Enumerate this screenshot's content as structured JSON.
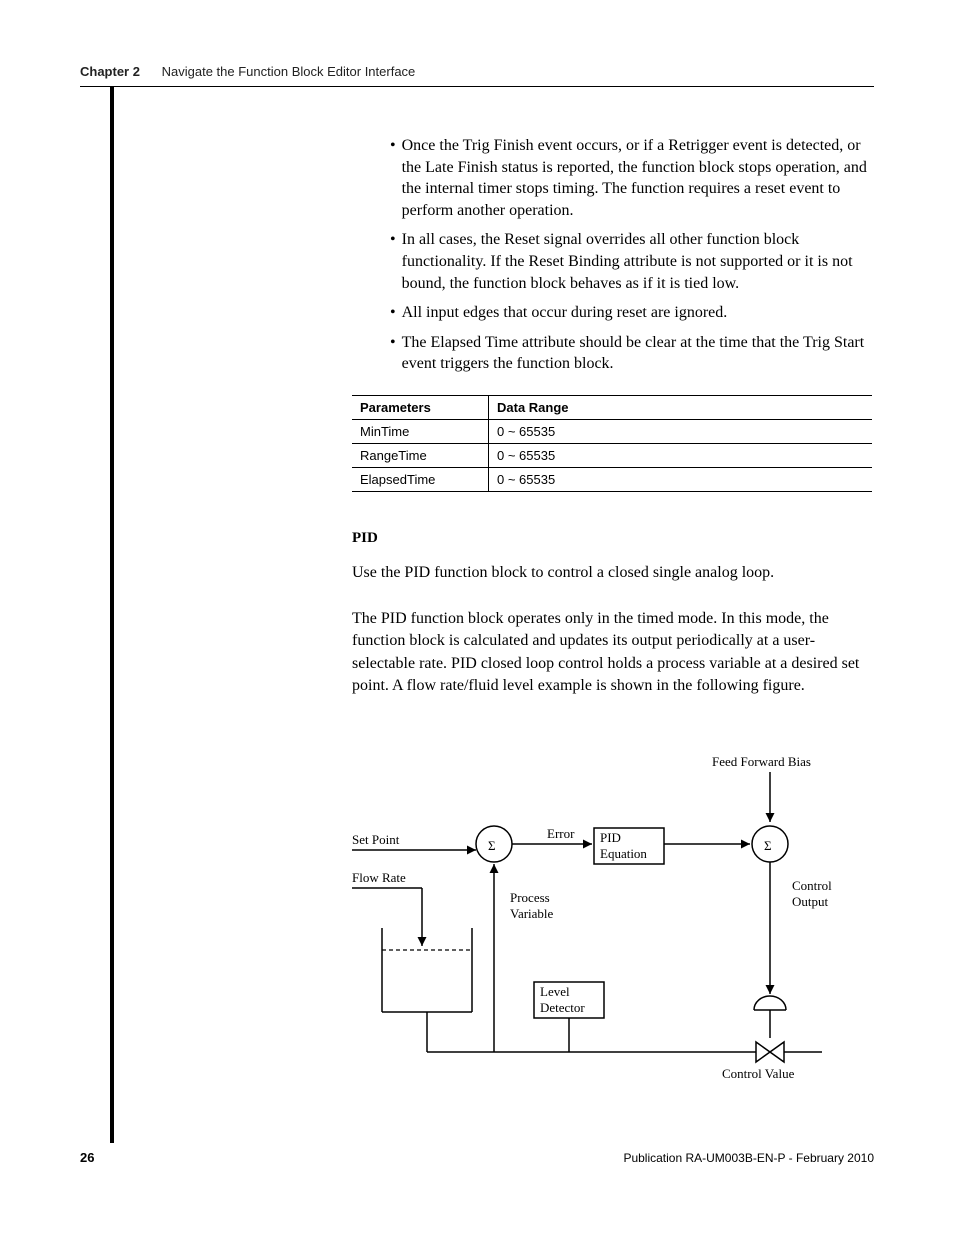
{
  "header": {
    "chapter_label": "Chapter 2",
    "chapter_title": "Navigate the Function Block Editor Interface"
  },
  "bullets": [
    "Once the Trig Finish event occurs, or if a Retrigger event is detected, or the Late Finish status is reported, the function block stops operation, and the internal timer stops timing. The function requires a reset event to perform another operation.",
    "In all cases, the Reset signal overrides all other function block functionality. If the Reset Binding attribute is not supported or it is not bound, the function block behaves as if it is tied low.",
    "All input edges that occur during reset are ignored.",
    "The Elapsed Time attribute should be clear at the time that the Trig Start event triggers the function block."
  ],
  "table": {
    "headers": [
      "Parameters",
      "Data Range"
    ],
    "rows": [
      [
        "MinTime",
        "0 ~ 65535"
      ],
      [
        "RangeTime",
        "0 ~ 65535"
      ],
      [
        "ElapsedTime",
        "0 ~ 65535"
      ]
    ]
  },
  "pid": {
    "heading": "PID",
    "line1": "Use the PID function block to control a closed single analog loop.",
    "para2": "The PID function block operates only in the timed mode. In this mode, the function block is calculated and updates its output periodically at a user-selectable rate. PID closed loop control holds a process variable at a desired set point. A flow rate/fluid level example is shown in the following figure."
  },
  "figure_labels": {
    "feed_forward": "Feed Forward Bias",
    "set_point": "Set Point",
    "flow_rate": "Flow Rate",
    "error": "Error",
    "pid_eq1": "PID",
    "pid_eq2": "Equation",
    "process1": "Process",
    "process2": "Variable",
    "level1": "Level",
    "level2": "Detector",
    "control1": "Control",
    "control2": "Output",
    "control_value": "Control Value",
    "sigma": "Σ"
  },
  "footer": {
    "page_num": "26",
    "pub": "Publication RA-UM003B-EN-P - February 2010"
  }
}
